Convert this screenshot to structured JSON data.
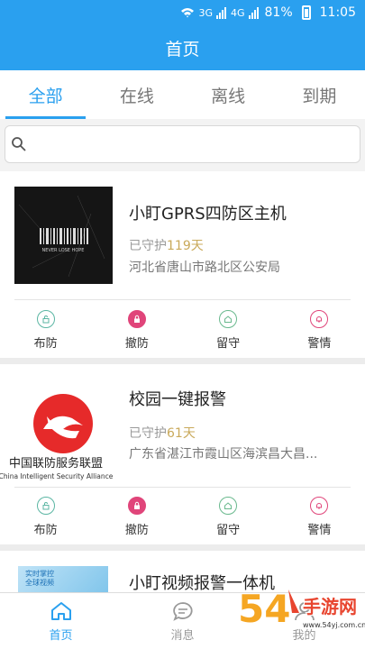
{
  "status": {
    "network": "3G",
    "network2": "4G",
    "battery": "81%",
    "time": "11:05"
  },
  "header": {
    "title": "首页"
  },
  "tabs": [
    {
      "label": "全部",
      "active": true
    },
    {
      "label": "在线",
      "active": false
    },
    {
      "label": "离线",
      "active": false
    },
    {
      "label": "到期",
      "active": false
    }
  ],
  "search": {
    "placeholder": ""
  },
  "devices": [
    {
      "title": "小盯GPRS四防区主机",
      "guard_prefix": "已守护",
      "guard_days": "119天",
      "address": "河北省唐山市路北区公安局",
      "thumb_caption": "NEVER LOSE HOPE"
    },
    {
      "title": "校园一键报警",
      "guard_prefix": "已守护",
      "guard_days": "61天",
      "address": "广东省湛江市霞山区海滨昌大昌...",
      "thumb_caption_cn": "中国联防服务联盟",
      "thumb_caption_en": "China Intelligent Security Alliance"
    },
    {
      "title": "小盯视频报警一体机",
      "thumb_caption": "实时掌控 全球视频"
    }
  ],
  "actions": [
    {
      "label": "布防",
      "icon": "lock-open-icon",
      "color": "#5bb6a3"
    },
    {
      "label": "撤防",
      "icon": "lock-icon",
      "color": "#e0457a"
    },
    {
      "label": "留守",
      "icon": "home-icon",
      "color": "#6ab98e"
    },
    {
      "label": "警情",
      "icon": "bell-icon",
      "color": "#e0457a"
    }
  ],
  "nav": [
    {
      "label": "首页",
      "icon": "home-icon",
      "active": true
    },
    {
      "label": "消息",
      "icon": "message-icon",
      "active": false
    },
    {
      "label": "我的",
      "icon": "user-icon",
      "active": false
    }
  ],
  "watermark": {
    "text_num": "54",
    "text_cn": "手游网",
    "url": "www.54yj.com.cn"
  },
  "colors": {
    "primary": "#2aa0ef",
    "days": "#c9a95a"
  }
}
